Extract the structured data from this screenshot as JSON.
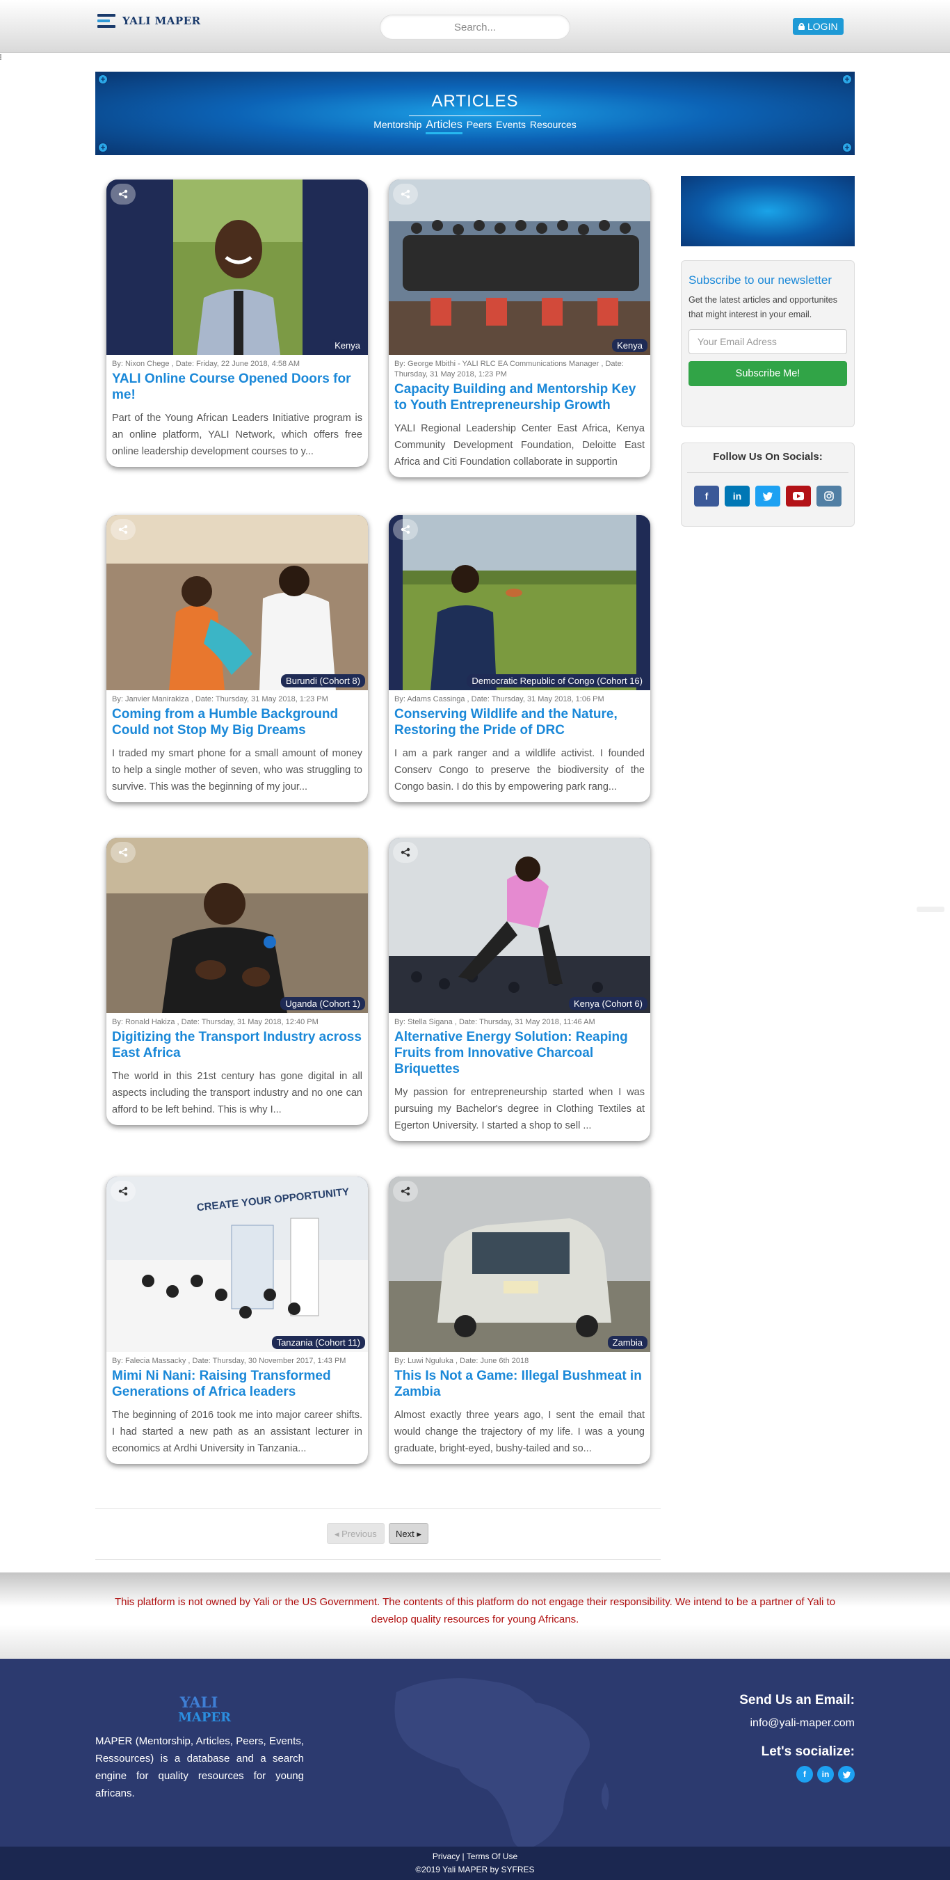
{
  "header": {
    "brand": "YALI MAPER",
    "search_placeholder": "Search...",
    "login_label": "LOGIN"
  },
  "banner": {
    "title": "ARTICLES",
    "menu": [
      "Mentorship",
      "Articles",
      "Peers",
      "Events",
      "Resources"
    ],
    "active": "Articles"
  },
  "articles": [
    {
      "location": "Kenya",
      "meta": "By: Nixon Chege , Date: Friday, 22 June 2018, 4:58 AM",
      "title": "YALI Online Course Opened Doors for me!",
      "excerpt": "Part of the Young African Leaders Initiative program is an online platform, YALI Network, which offers free online leadership development courses to y..."
    },
    {
      "location": "Kenya",
      "meta": "By: George Mbithi - YALI RLC EA Communications Manager , Date: Thursday, 31 May 2018, 1:23 PM",
      "title": "Capacity Building and Mentorship Key to Youth Entrepreneurship Growth",
      "excerpt": "YALI Regional Leadership Center East Africa, Kenya Community Development Foundation, Deloitte East Africa and Citi Foundation collaborate in supportin"
    },
    {
      "location": "Burundi (Cohort 8)",
      "meta": "By: Janvier Manirakiza , Date: Thursday, 31 May 2018, 1:23 PM",
      "title": "Coming from a Humble Background Could not Stop My Big Dreams",
      "excerpt": "I traded my smart phone for a small amount of money to help a single mother of seven, who was struggling to survive. This was the beginning of my jour..."
    },
    {
      "location": "Democratic Republic of Congo (Cohort 16)",
      "meta": "By: Adams Cassinga , Date: Thursday, 31 May 2018, 1:06 PM",
      "title": "Conserving Wildlife and the Nature, Restoring the Pride of DRC",
      "excerpt": "I am a park ranger and a wildlife activist. I founded Conserv Congo to preserve the biodiversity of the Congo basin. I do this by empowering park rang..."
    },
    {
      "location": "Uganda (Cohort 1)",
      "meta": "By: Ronald Hakiza , Date: Thursday, 31 May 2018, 12:40 PM",
      "title": "Digitizing the Transport Industry across East Africa",
      "excerpt": "The world in this 21st century has gone digital in all aspects including the transport industry and no one can afford to be left behind. This is why I..."
    },
    {
      "location": "Kenya (Cohort 6)",
      "meta": "By: Stella Sigana , Date: Thursday, 31 May 2018, 11:46 AM",
      "title": "Alternative Energy Solution: Reaping Fruits from Innovative Charcoal Briquettes",
      "excerpt": "My passion for entrepreneurship started when I was pursuing my Bachelor's degree in Clothing Textiles at Egerton University. I started a shop to sell ..."
    },
    {
      "location": "Tanzania (Cohort 11)",
      "meta": "By: Falecia Massacky , Date: Thursday, 30 November 2017, 1:43 PM",
      "title": "Mimi Ni Nani: Raising Transformed Generations of Africa leaders",
      "excerpt": "The beginning of 2016 took me into major career shifts. I had started a new path as an assistant lecturer in economics at Ardhi University in Tanzania..."
    },
    {
      "location": "Zambia",
      "meta": "By: Luwi Nguluka , Date: June 6th 2018",
      "title": "This Is Not a Game: Illegal Bushmeat in Zambia",
      "excerpt": "Almost exactly three years ago, I sent the email that would change the trajectory of my life. I was a young graduate, bright-eyed, bushy-tailed and so..."
    }
  ],
  "image_captions": {
    "tanzania_banner": "CREATE YOUR OPPORTUNITY"
  },
  "newsletter": {
    "title": "Subscribe to our newsletter",
    "text": "Get the latest articles and opportunites that might interest in your email.",
    "placeholder": "Your Email Adress",
    "button": "Subscribe Me!"
  },
  "social": {
    "title": "Follow Us On Socials:",
    "icons": [
      "facebook-icon",
      "linkedin-icon",
      "twitter-icon",
      "youtube-icon",
      "instagram-icon"
    ]
  },
  "pagination": {
    "previous": "Previous",
    "next": "Next"
  },
  "disclaimer": "This platform is not owned by Yali or the US Government. The contents of this platform do not engage their responsibility. We intend to be a partner of Yali to develop quality resources for young Africans.",
  "footer": {
    "logo_line1": "YALI",
    "logo_line2": "MAPER",
    "description": "MAPER (Mentorship, Articles, Peers, Events, Ressources) is a database and a search engine for quality resources for young africans.",
    "email_heading": "Send Us an Email:",
    "email": "info@yali-maper.com",
    "social_heading": "Let's socialize:",
    "links": "Privacy | Terms Of Use",
    "copyright": "©2019 Yali MAPER by SYFRES"
  },
  "colors": {
    "accent": "#1a88d8",
    "navy": "#2c3a6f",
    "login": "#1e9ad6",
    "subscribe": "#31a447",
    "disclaimer": "#b01010"
  }
}
